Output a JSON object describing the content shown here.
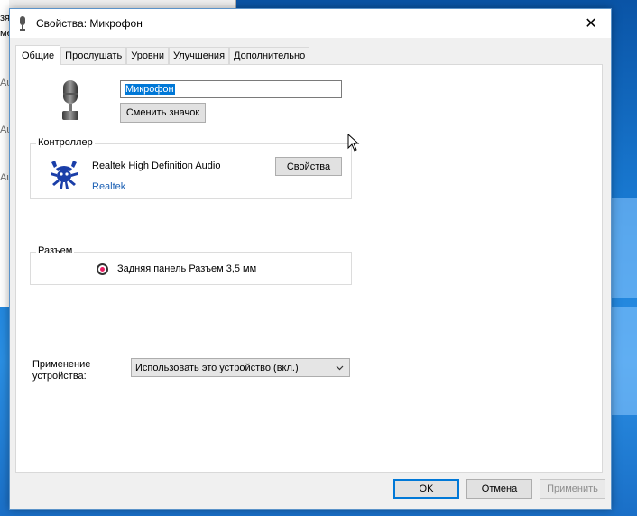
{
  "background_window": {
    "fragments": [
      "зя",
      "ме",
      "Au",
      "Au",
      "Au"
    ]
  },
  "dialog": {
    "title": "Свойства: Микрофон",
    "close_label": "✕",
    "tabs": [
      {
        "label": "Общие",
        "active": true
      },
      {
        "label": "Прослушать",
        "active": false
      },
      {
        "label": "Уровни",
        "active": false
      },
      {
        "label": "Улучшения",
        "active": false
      },
      {
        "label": "Дополнительно",
        "active": false
      }
    ],
    "general": {
      "device_icon": "microphone-icon",
      "device_name": "Микрофон",
      "change_icon_label": "Сменить значок",
      "controller": {
        "legend": "Контроллер",
        "icon": "realtek-crab-icon",
        "name": "Realtek High Definition Audio",
        "vendor": "Realtek",
        "properties_label": "Свойства"
      },
      "jack": {
        "legend": "Разъем",
        "color": "#e91e63",
        "label": "Задняя панель Разъем 3,5 мм"
      },
      "usage": {
        "label_line1": "Применение",
        "label_line2": "устройства:",
        "selected": "Использовать это устройство (вкл.)"
      }
    },
    "buttons": {
      "ok": "OK",
      "cancel": "Отмена",
      "apply": "Применить"
    }
  },
  "colors": {
    "accent": "#0078d7",
    "link": "#1a5fb4",
    "desktop": "#1b7fd8"
  }
}
